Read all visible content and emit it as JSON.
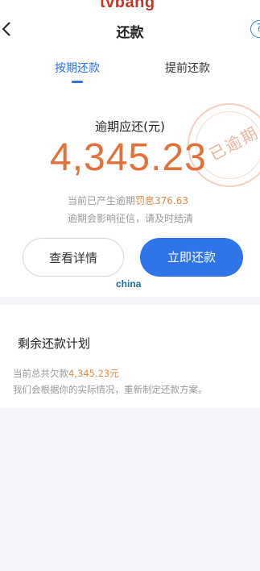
{
  "watermark_top": "tvbang",
  "header": {
    "title": "还款",
    "help_glyph": "?"
  },
  "tabs": [
    {
      "label": "按期还款",
      "active": true
    },
    {
      "label": "提前还款",
      "active": false
    }
  ],
  "stamp": {
    "text": "已逾期"
  },
  "overdue": {
    "label": "逾期应还(元)",
    "amount": "4,345.23",
    "info1_prefix": "当前已产生逾期",
    "info1_penalty": "罚息376.63",
    "info2": "逾期会影响征信，请及时结清"
  },
  "buttons": {
    "detail": "查看详情",
    "repay": "立即还款"
  },
  "watermark_mid": "china",
  "plan": {
    "title": "剩余还款计划",
    "line1_prefix": "当前总共欠款",
    "line1_amount": "4,345.23元",
    "line2": "我们会根据你的实际情况，重新制定还款方案。"
  },
  "colors": {
    "accent_blue": "#2f74e8",
    "amount_orange": "#e2703a",
    "penalty_orange": "#e08a4a"
  }
}
